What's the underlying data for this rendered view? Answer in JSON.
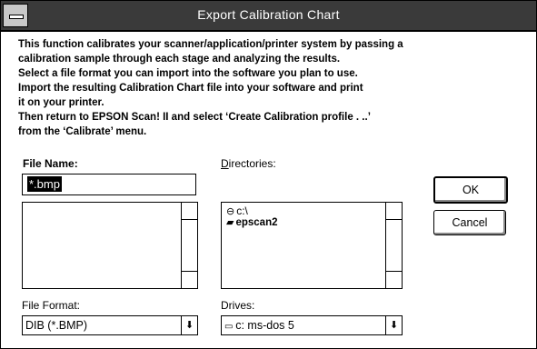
{
  "window": {
    "title": "Export Calibration Chart"
  },
  "description_lines": [
    "This function calibrates your scanner/application/printer system by passing a",
    "calibration sample through each stage and analyzing the results.",
    " Select a file format you can import into the software you plan to use.",
    " Import the resulting Calibration Chart file into your software and print",
    "it on your printer.",
    " Then return to EPSON Scan! II and select ‘Create Calibration profile . ..’",
    "from the ‘Calibrate’ menu."
  ],
  "file_name": {
    "label": "File Name:",
    "value": "*.bmp"
  },
  "directories": {
    "label": "Directories:",
    "items": [
      {
        "name": "c:\\",
        "icon": "open-folder-icon"
      },
      {
        "name": "epscan2",
        "icon": "folder-icon"
      }
    ]
  },
  "file_format": {
    "label": "File Format:",
    "value": "DIB (*.BMP)"
  },
  "drives": {
    "label": "Drives:",
    "value": "c: ms-dos 5",
    "icon": "drive-icon"
  },
  "buttons": {
    "ok": "OK",
    "cancel": "Cancel"
  },
  "icons": {
    "dropdown": "dropdown-arrow-icon",
    "system_menu": "system-menu-icon"
  }
}
